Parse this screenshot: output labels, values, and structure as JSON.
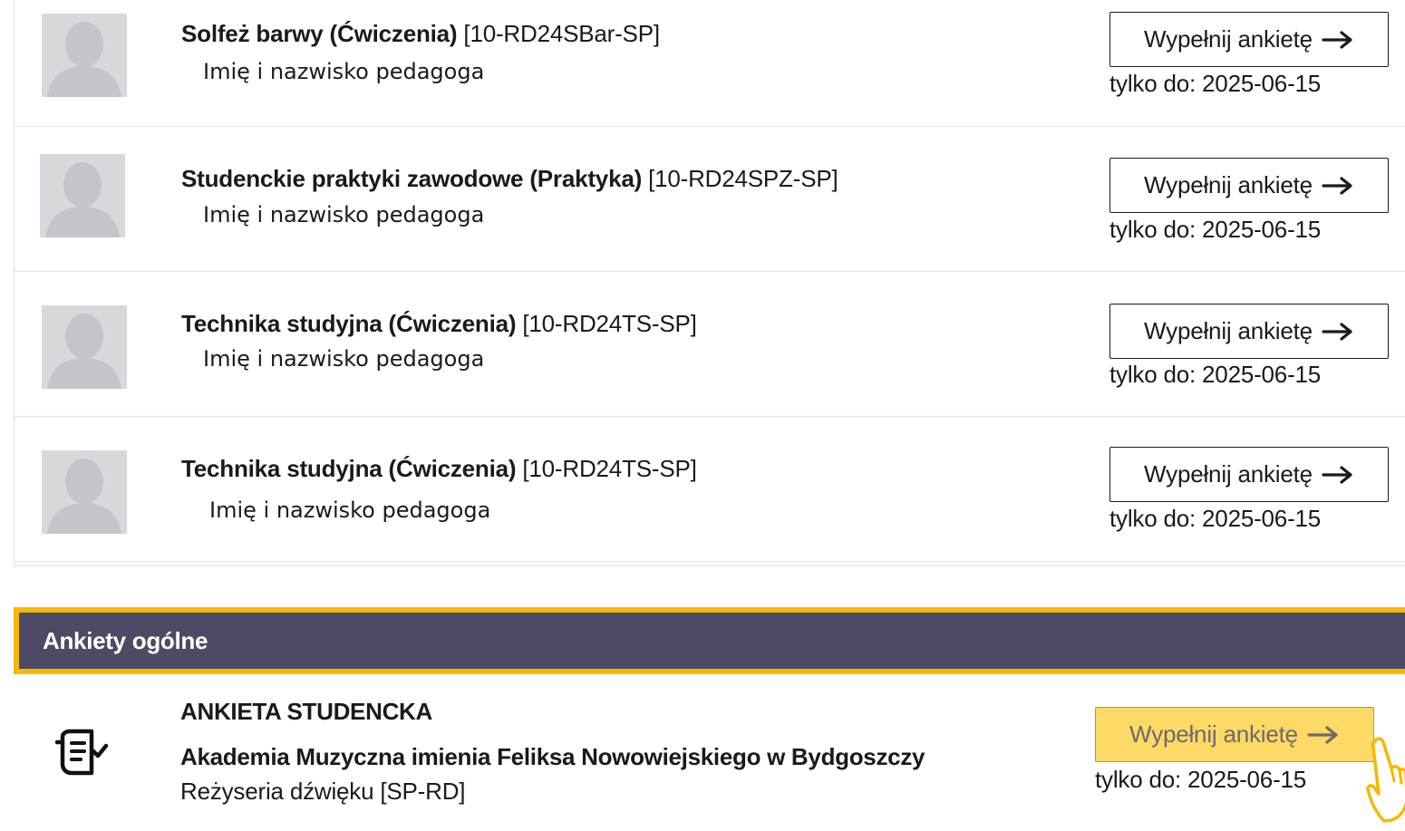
{
  "courses": [
    {
      "name": "Solfeż barwy (Ćwiczenia)",
      "code": "[10-RD24SBar-SP]",
      "teacher": "Imię i nazwisko pedagoga",
      "button_label": "Wypełnij ankietę",
      "deadline": "tylko do: 2025-06-15"
    },
    {
      "name": "Studenckie praktyki zawodowe (Praktyka)",
      "code": "[10-RD24SPZ-SP]",
      "teacher": "Imię i nazwisko pedagoga",
      "button_label": "Wypełnij ankietę",
      "deadline": "tylko do: 2025-06-15"
    },
    {
      "name": "Technika studyjna (Ćwiczenia)",
      "code": "[10-RD24TS-SP]",
      "teacher": "Imię i nazwisko pedagoga",
      "button_label": "Wypełnij ankietę",
      "deadline": "tylko do: 2025-06-15"
    },
    {
      "name": "Technika studyjna (Ćwiczenia)",
      "code": "[10-RD24TS-SP]",
      "teacher": "Imię i nazwisko pedagoga",
      "button_label": "Wypełnij ankietę",
      "deadline": "tylko do: 2025-06-15"
    }
  ],
  "general_section": {
    "header": "Ankiety ogólne",
    "survey": {
      "title": "ANKIETA STUDENCKA",
      "organization": "Akademia Muzyczna imienia Feliksa Nowowiejskiego w Bydgoszczy",
      "program": "Reżyseria dźwięku [SP-RD]",
      "button_label": "Wypełnij ankietę",
      "deadline": "tylko do: 2025-06-15",
      "icon": "survey-form-icon"
    }
  },
  "colors": {
    "section_header_bg": "#4d4a66",
    "highlight_border": "#f5b800",
    "highlight_button_bg": "#ffd966"
  }
}
